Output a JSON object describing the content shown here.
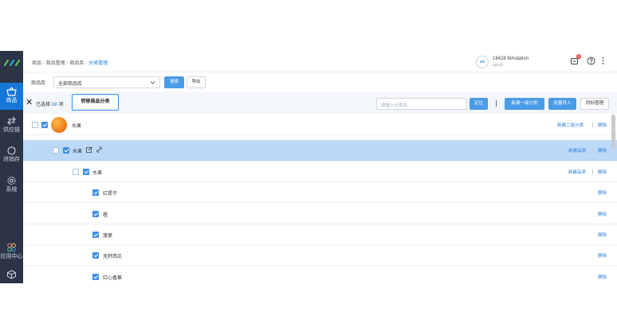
{
  "nav": {
    "items": [
      {
        "label": "商品",
        "icon": "basket-icon",
        "active": true
      },
      {
        "label": "供应链",
        "icon": "supply-chain-icon"
      },
      {
        "label": "进销存",
        "icon": "inventory-icon"
      },
      {
        "label": "系统",
        "icon": "gear-icon"
      },
      {
        "label": "应用中心",
        "icon": "app-center-icon"
      },
      {
        "label": "",
        "icon": "cube-icon"
      }
    ]
  },
  "breadcrumb": [
    "商品",
    "商品管理",
    "商品库",
    "分类管理"
  ],
  "account": {
    "avatar_text": "AV",
    "name": "18428 MAstation",
    "sub": "ozcs2",
    "notification_count": "5"
  },
  "filter": {
    "label": "商品库",
    "select_value": "全部商品库",
    "search_button": "搜索",
    "export_button": "导出"
  },
  "selection": {
    "prefix": "已选择",
    "count": "68",
    "suffix": "项",
    "move_button": "转移商品分类"
  },
  "toolbar": {
    "search_placeholder": "请输入分类名",
    "locate_button": "定位",
    "new_top_button": "新建一级分类",
    "batch_import_button": "批量导入",
    "manage_button": "同标管理"
  },
  "rows": [
    {
      "name": "水果",
      "actions": [
        "新建二级分类",
        "删除"
      ]
    },
    {
      "name": "水果",
      "actions": [
        "新建品类",
        "删除"
      ]
    },
    {
      "name": "水果",
      "actions": [
        "新建品类",
        "删除"
      ]
    },
    {
      "name": "红提子",
      "actions": [
        "删除"
      ]
    },
    {
      "name": "橙",
      "actions": [
        "删除"
      ]
    },
    {
      "name": "菠萝",
      "actions": [
        "删除"
      ]
    },
    {
      "name": "无籽西瓜",
      "actions": [
        "删除"
      ]
    },
    {
      "name": "红心香蕉",
      "actions": [
        "删除"
      ]
    }
  ],
  "colors": {
    "sidebar": "#2b3546",
    "primary": "#1677d9",
    "highlight_row": "#bcd9f8",
    "link": "#2a7fd9"
  }
}
